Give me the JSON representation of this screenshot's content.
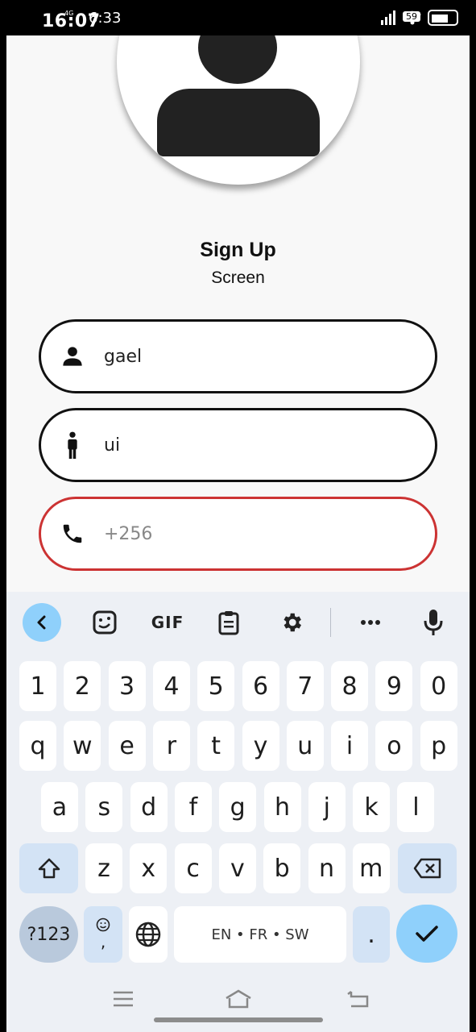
{
  "status_bar": {
    "time_main": "16:07",
    "time_overlay": "6:33",
    "network_label": "4G",
    "battery_level": "59",
    "icons": [
      "signal-icon",
      "wifi-icon",
      "battery-icon"
    ]
  },
  "avatar": {
    "icon": "person-avatar-icon"
  },
  "header": {
    "title": "Sign Up",
    "subtitle": "Screen"
  },
  "form": {
    "fields": [
      {
        "name": "username-field",
        "icon": "person-icon",
        "value": "gael",
        "placeholder": "",
        "state": "normal"
      },
      {
        "name": "name-field",
        "icon": "standing-person-icon",
        "value": "ui",
        "placeholder": "",
        "state": "normal"
      },
      {
        "name": "phone-field",
        "icon": "phone-icon",
        "value": "",
        "placeholder": "+256",
        "state": "error"
      }
    ]
  },
  "keyboard": {
    "toolbar": {
      "items": [
        "back-icon",
        "sticker-icon",
        "gif-button",
        "clipboard-icon",
        "settings-icon",
        "more-icon",
        "mic-icon"
      ],
      "gif_label": "GIF"
    },
    "rows": {
      "numbers": [
        "1",
        "2",
        "3",
        "4",
        "5",
        "6",
        "7",
        "8",
        "9",
        "0"
      ],
      "row1": [
        "q",
        "w",
        "e",
        "r",
        "t",
        "y",
        "u",
        "i",
        "o",
        "p"
      ],
      "row2": [
        "a",
        "s",
        "d",
        "f",
        "g",
        "h",
        "j",
        "k",
        "l"
      ],
      "row3": [
        "z",
        "x",
        "c",
        "v",
        "b",
        "n",
        "m"
      ]
    },
    "symbols_label": "?123",
    "emoji_comma_label": ",",
    "space_label": "EN • FR • SW",
    "period_label": ".",
    "colors": {
      "accent": "#8fd0fb",
      "modifier": "#d3e3f5",
      "symbol": "#b9c9dc"
    }
  },
  "navbar": {
    "icons": [
      "recents-icon",
      "home-icon",
      "back-nav-icon"
    ]
  },
  "colors": {
    "error_border": "#cc3333",
    "avatar_fill": "#222222",
    "background": "#f8f8f8"
  }
}
